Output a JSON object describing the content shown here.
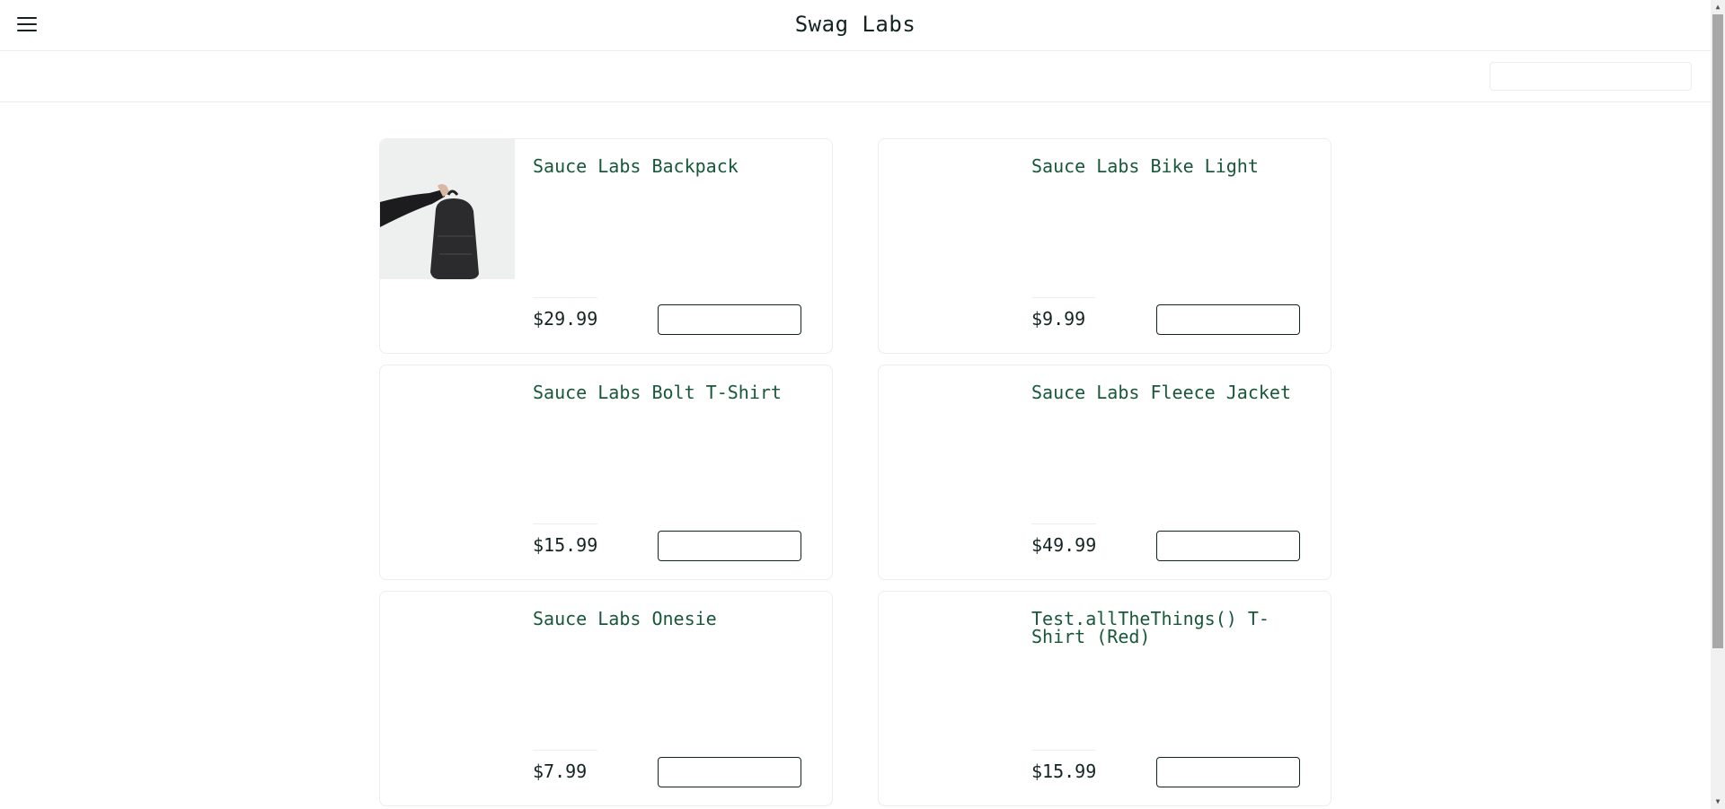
{
  "header": {
    "title": "Swag Labs",
    "menu_icon": "hamburger-menu-icon"
  },
  "subheader": {
    "sort_value": ""
  },
  "products": [
    {
      "name": "Sauce Labs Backpack",
      "price": "$29.99",
      "button_label": "",
      "has_image": true
    },
    {
      "name": "Sauce Labs Bike Light",
      "price": "$9.99",
      "button_label": "",
      "has_image": false
    },
    {
      "name": "Sauce Labs Bolt T-Shirt",
      "price": "$15.99",
      "button_label": "",
      "has_image": false
    },
    {
      "name": "Sauce Labs Fleece Jacket",
      "price": "$49.99",
      "button_label": "",
      "has_image": false
    },
    {
      "name": "Sauce Labs Onesie",
      "price": "$7.99",
      "button_label": "",
      "has_image": false
    },
    {
      "name": "Test.allTheThings() T-Shirt (Red)",
      "price": "$15.99",
      "button_label": "",
      "has_image": false
    }
  ],
  "colors": {
    "item_name": "#18583a",
    "text": "#132322",
    "border": "#ededed"
  }
}
